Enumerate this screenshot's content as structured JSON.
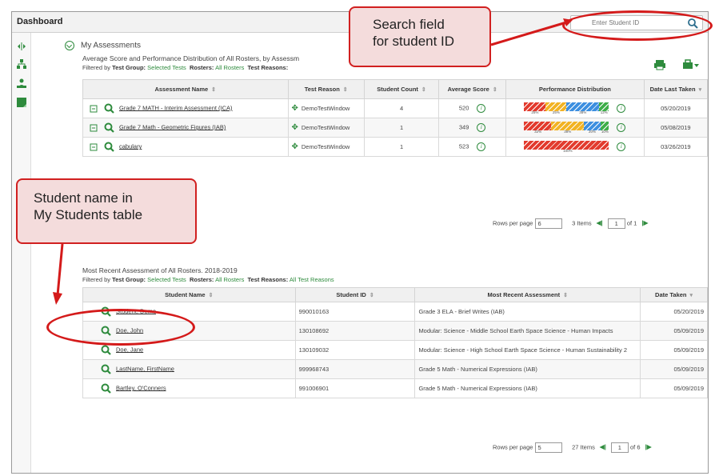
{
  "dashboard": {
    "title": "Dashboard"
  },
  "search": {
    "placeholder": "Enter Student ID"
  },
  "my_assessments": {
    "heading": "My Assessments",
    "subtitle": "Average Score and Performance Distribution of All Rosters, by Assessm",
    "filter_prefix": "Filtered by",
    "filter_test_group_label": "Test Group:",
    "filter_test_group_value": "Selected Tests",
    "filter_rosters_label": "Rosters:",
    "filter_rosters_value": "All Rosters",
    "filter_reasons_label": "Test Reasons:",
    "columns": [
      "Assessment Name",
      "Test Reason",
      "Student Count",
      "Average Score",
      "Performance Distribution",
      "Date Last Taken"
    ],
    "rows": [
      {
        "name": "Grade 7 MATH - Interim Assessment (ICA)",
        "reason": "DemoTestWindow",
        "count": "4",
        "score": "520",
        "date": "05/20/2019",
        "dist": [
          {
            "pct": 25,
            "label": "25%",
            "color": "#e23b2e"
          },
          {
            "pct": 25,
            "label": "25%",
            "color": "#f2b324"
          },
          {
            "pct": 38,
            "label": "38%",
            "color": "#3d8fe0"
          },
          {
            "pct": 12,
            "label": "12%",
            "color": "#3fae49"
          }
        ]
      },
      {
        "name": "Grade 7 Math - Geometric Figures (IAB)",
        "reason": "DemoTestWindow",
        "count": "1",
        "score": "349",
        "date": "05/08/2019",
        "dist": [
          {
            "pct": 32,
            "label": "32%",
            "color": "#e23b2e"
          },
          {
            "pct": 38,
            "label": "38%",
            "color": "#f2b324"
          },
          {
            "pct": 20,
            "label": "20%",
            "color": "#3d8fe0"
          },
          {
            "pct": 10,
            "label": "10%",
            "color": "#3fae49"
          }
        ]
      },
      {
        "name": "cabulary",
        "reason": "DemoTestWindow",
        "count": "1",
        "score": "523",
        "date": "03/26/2019",
        "dist": [
          {
            "pct": 100,
            "label": "100%",
            "color": "#e23b2e"
          }
        ]
      }
    ],
    "pager": {
      "rows_label": "Rows per page",
      "rows_value": "6",
      "items": "3 Items",
      "page": "1",
      "of": "of 1"
    }
  },
  "my_students": {
    "subtitle": "Most Recent Assessment of All Rosters. 2018-2019",
    "filter_prefix": "Filtered by",
    "filter_test_group_label": "Test Group:",
    "filter_test_group_value": "Selected Tests",
    "filter_rosters_label": "Rosters:",
    "filter_rosters_value": "All Rosters",
    "filter_reasons_label": "Test Reasons:",
    "filter_reasons_value": "All Test Reasons",
    "columns": [
      "Student Name",
      "Student ID",
      "Most Recent Assessment",
      "Date Taken"
    ],
    "rows": [
      {
        "name": "Student, Demo",
        "id": "990010163",
        "assessment": "Grade 3 ELA - Brief Writes (IAB)",
        "date": "05/20/2019"
      },
      {
        "name": "Doe, John",
        "id": "130108692",
        "assessment": "Modular: Science - Middle School Earth Space Science - Human Impacts",
        "date": "05/09/2019"
      },
      {
        "name": "Doe, Jane",
        "id": "130109032",
        "assessment": "Modular: Science - High School Earth Space Science - Human Sustainability 2",
        "date": "05/09/2019"
      },
      {
        "name": "LastName, FirstName",
        "id": "999968743",
        "assessment": "Grade 5 Math - Numerical Expressions (IAB)",
        "date": "05/09/2019"
      },
      {
        "name": "Bartley, O'Conners",
        "id": "991006901",
        "assessment": "Grade 5 Math - Numerical Expressions (IAB)",
        "date": "05/09/2019"
      }
    ],
    "pager": {
      "rows_label": "Rows per page",
      "rows_value": "5",
      "items": "27 Items",
      "page": "1",
      "of": "of 6"
    }
  },
  "callouts": {
    "search": "Search field\nfor student ID",
    "student_name": "Student name in\nMy Students table"
  },
  "colors": {
    "accent_green": "#2e8b3d",
    "callout_border": "#d12020",
    "callout_fill": "#f4dcdc"
  }
}
